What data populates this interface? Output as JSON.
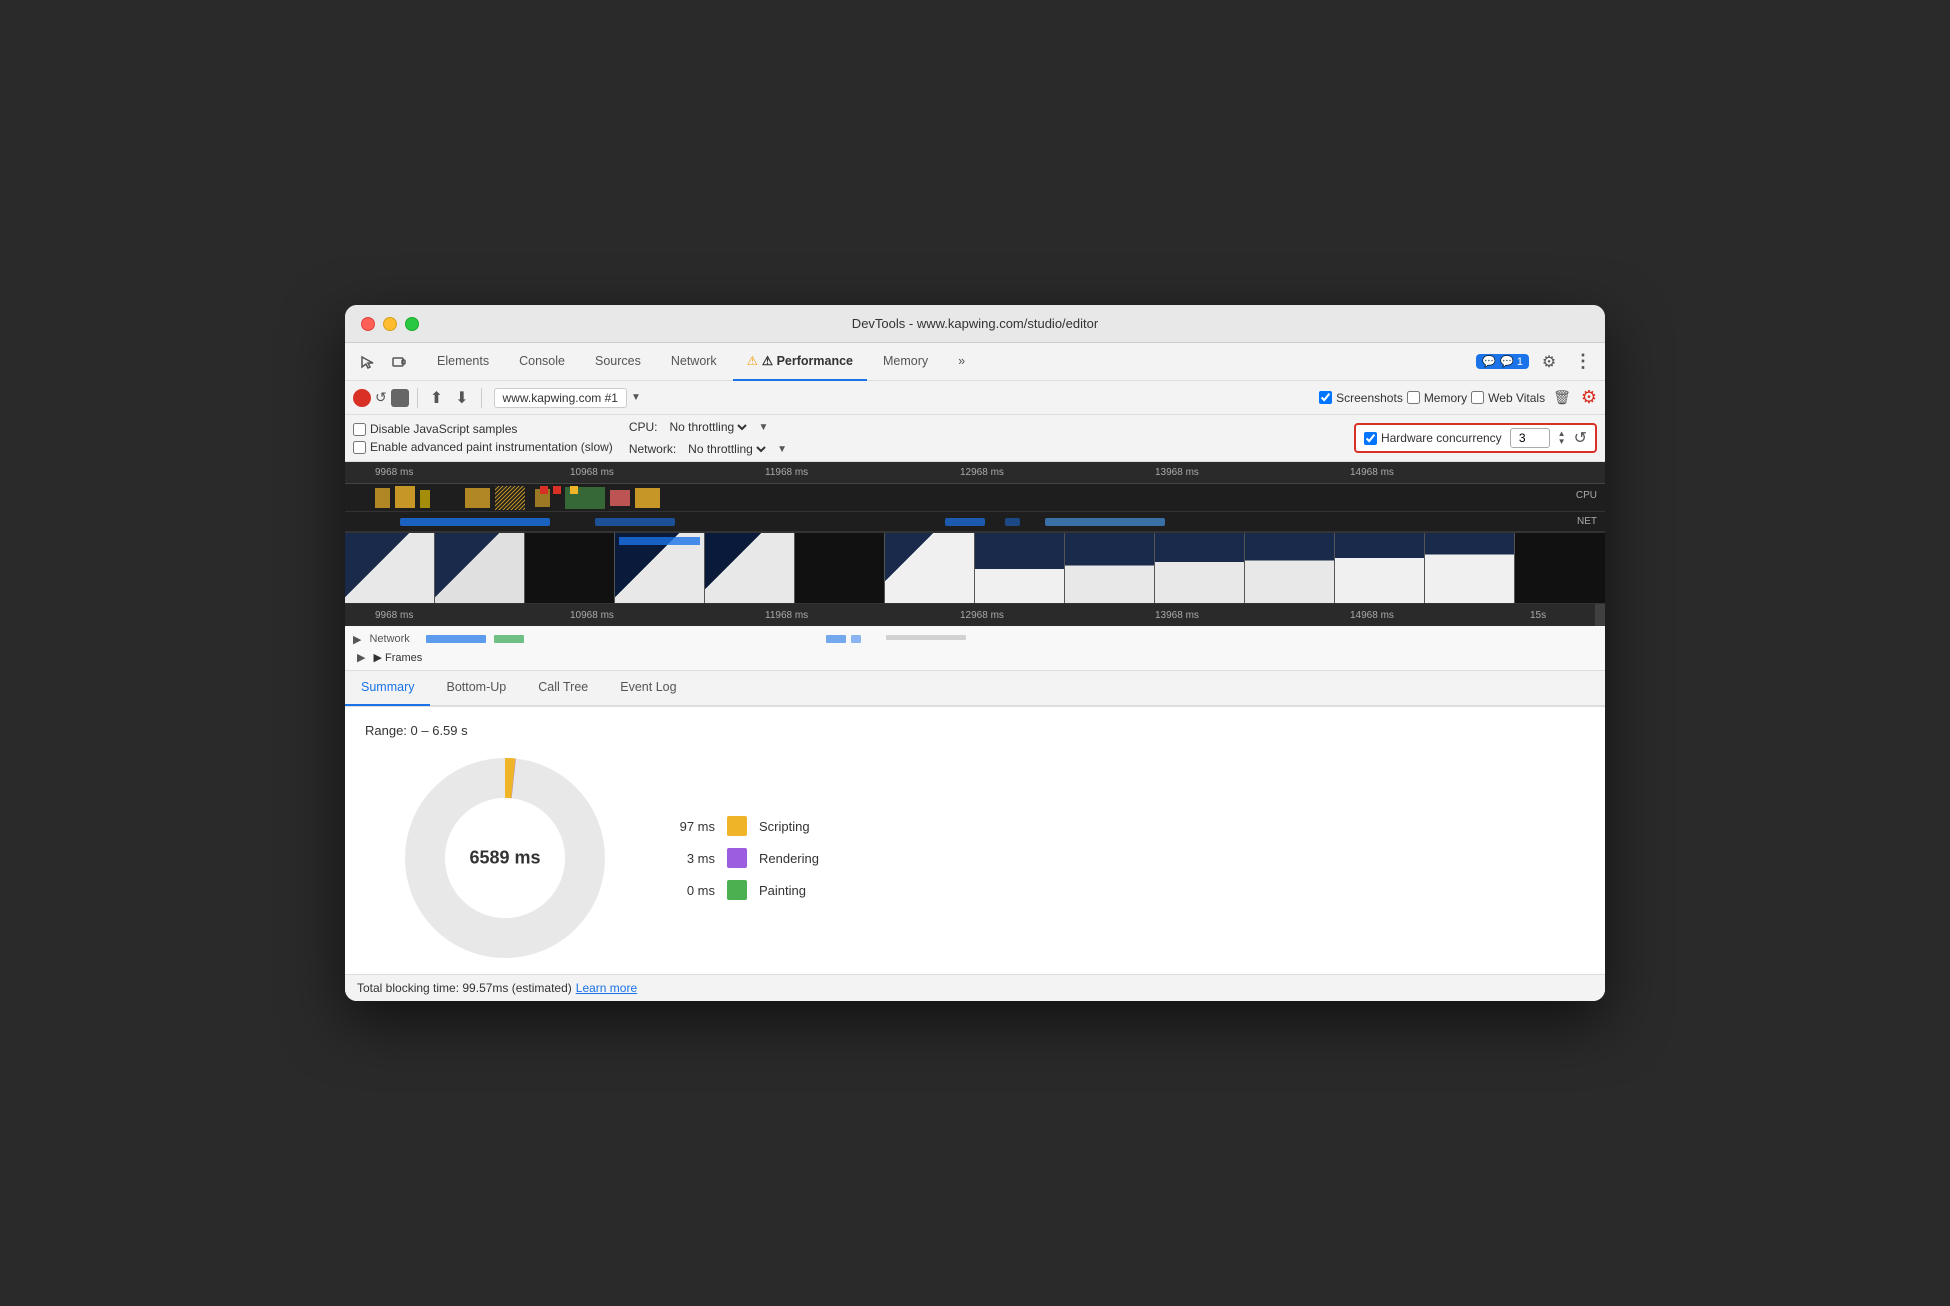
{
  "window": {
    "title": "DevTools - www.kapwing.com/studio/editor"
  },
  "tabs": {
    "items": [
      {
        "label": "Elements",
        "active": false
      },
      {
        "label": "Console",
        "active": false
      },
      {
        "label": "Sources",
        "active": false
      },
      {
        "label": "Network",
        "active": false
      },
      {
        "label": "⚠ Performance",
        "active": true
      },
      {
        "label": "Memory",
        "active": false
      },
      {
        "label": "»",
        "active": false
      }
    ],
    "badge": "💬 1",
    "gear_icon": "⚙",
    "more_icon": "⋮"
  },
  "recording_bar": {
    "url_text": "www.kapwing.com #1",
    "screenshots_label": "Screenshots",
    "screenshots_checked": true,
    "memory_label": "Memory",
    "memory_checked": false,
    "web_vitals_label": "Web Vitals",
    "web_vitals_checked": false
  },
  "options_bar": {
    "disable_js_label": "Disable JavaScript samples",
    "disable_js_checked": false,
    "enable_paint_label": "Enable advanced paint instrumentation (slow)",
    "enable_paint_checked": false,
    "cpu_label": "CPU:",
    "cpu_value": "No throttling",
    "network_label": "Network:",
    "network_value": "No throttling",
    "hw_concurrency_label": "Hardware concurrency",
    "hw_concurrency_checked": true,
    "hw_concurrency_value": "3"
  },
  "timeline": {
    "markers": [
      "9968 ms",
      "10968 ms",
      "11968 ms",
      "12968 ms",
      "13968 ms",
      "14968 ms"
    ],
    "markers_bottom": [
      "9968 ms",
      "10968 ms",
      "11968 ms",
      "12968 ms",
      "13968 ms",
      "14968 ms",
      "15s"
    ],
    "cpu_label": "CPU",
    "net_label": "NET"
  },
  "bottom_section": {
    "tabs": [
      "Summary",
      "Bottom-Up",
      "Call Tree",
      "Event Log"
    ],
    "active_tab": "Summary",
    "range_text": "Range: 0 – 6.59 s",
    "pie": {
      "total_ms": "6589 ms",
      "items": [
        {
          "ms": "97 ms",
          "label": "Scripting",
          "color": "#f0b429"
        },
        {
          "ms": "3 ms",
          "label": "Rendering",
          "color": "#9c5de0"
        },
        {
          "ms": "0 ms",
          "label": "Painting",
          "color": "#4caf50"
        }
      ]
    },
    "status_bar": {
      "text": "Total blocking time: 99.57ms (estimated)",
      "link": "Learn more"
    }
  },
  "network_area": {
    "network_label": "▶ Network",
    "frames_label": "▶ Frames"
  }
}
